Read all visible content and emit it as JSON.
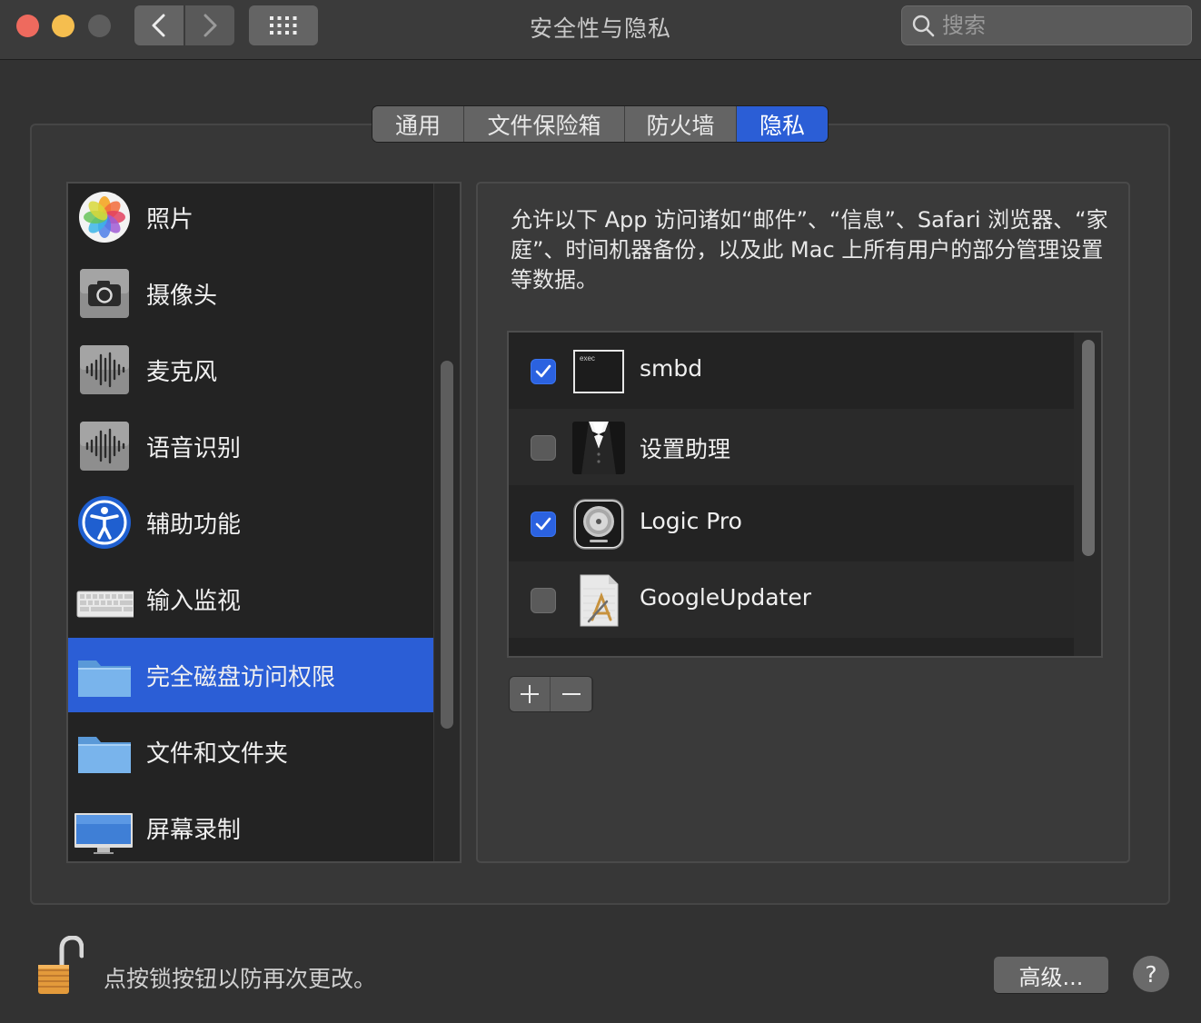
{
  "window": {
    "title": "安全性与隐私",
    "search_placeholder": "搜索"
  },
  "tabs": [
    {
      "label": "通用",
      "active": false
    },
    {
      "label": "文件保险箱",
      "active": false
    },
    {
      "label": "防火墙",
      "active": false
    },
    {
      "label": "隐私",
      "active": true
    }
  ],
  "sidebar": {
    "items": [
      {
        "label": "照片",
        "icon": "photos-icon",
        "selected": false
      },
      {
        "label": "摄像头",
        "icon": "camera-icon",
        "selected": false
      },
      {
        "label": "麦克风",
        "icon": "microphone-icon",
        "selected": false
      },
      {
        "label": "语音识别",
        "icon": "speech-recognition-icon",
        "selected": false
      },
      {
        "label": "辅助功能",
        "icon": "accessibility-icon",
        "selected": false
      },
      {
        "label": "输入监视",
        "icon": "keyboard-icon",
        "selected": false
      },
      {
        "label": "完全磁盘访问权限",
        "icon": "folder-icon",
        "selected": true
      },
      {
        "label": "文件和文件夹",
        "icon": "folder-icon",
        "selected": false
      },
      {
        "label": "屏幕录制",
        "icon": "display-icon",
        "selected": false
      }
    ]
  },
  "main": {
    "description": "允许以下 App 访问诸如“邮件”、“信息”、Safari 浏览器、“家庭”、时间机器备份，以及此 Mac 上所有用户的部分管理设置等数据。",
    "apps": [
      {
        "name": "smbd",
        "checked": true,
        "icon": "exec-terminal-icon",
        "icon_text": "exec"
      },
      {
        "name": "设置助理",
        "checked": false,
        "icon": "tuxedo-icon"
      },
      {
        "name": "Logic Pro",
        "checked": true,
        "icon": "logic-pro-icon"
      },
      {
        "name": "GoogleUpdater",
        "checked": false,
        "icon": "app-document-icon"
      }
    ],
    "add_label": "+",
    "remove_label": "−"
  },
  "footer": {
    "lock_text": "点按锁按钮以防再次更改。",
    "advanced_label": "高级...",
    "help_label": "?"
  },
  "colors": {
    "accent": "#2b5ed6",
    "window_bg": "#323232",
    "list_bg": "#232323"
  }
}
